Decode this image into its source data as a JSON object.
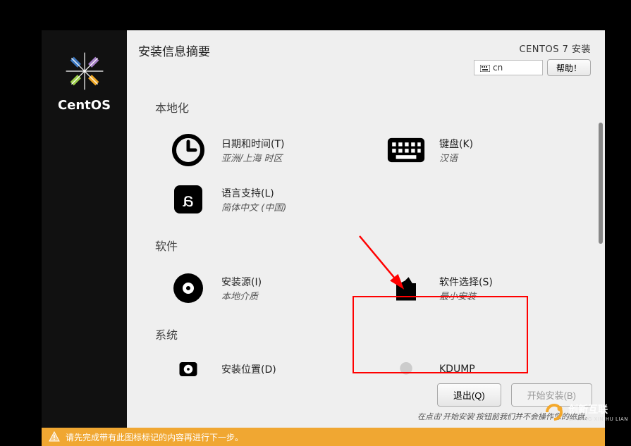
{
  "sidebar": {
    "brand": "CentOS"
  },
  "header": {
    "title_left": "安装信息摘要",
    "title_right": "CENTOS 7 安装",
    "keyboard_lang": "cn",
    "help_label": "帮助！"
  },
  "categories": [
    {
      "title": "本地化",
      "rows": [
        [
          {
            "icon": "clock-icon",
            "title": "日期和时间(T)",
            "sub": "亚洲/上海 时区"
          },
          {
            "icon": "keyboard-icon",
            "title": "键盘(K)",
            "sub": "汉语"
          }
        ],
        [
          {
            "icon": "language-icon",
            "title": "语言支持(L)",
            "sub": "简体中文 (中国)"
          }
        ]
      ]
    },
    {
      "title": "软件",
      "rows": [
        [
          {
            "icon": "disc-icon",
            "title": "安装源(I)",
            "sub": "本地介质"
          },
          {
            "icon": "package-icon",
            "title": "软件选择(S)",
            "sub": "最小安装",
            "highlighted": true
          }
        ]
      ]
    },
    {
      "title": "系统",
      "rows": [
        [
          {
            "icon": "disk-icon",
            "title": "安装位置(D)",
            "sub": ""
          },
          {
            "icon": "kdump-icon",
            "title": "KDUMP",
            "sub": ""
          }
        ]
      ]
    }
  ],
  "footer": {
    "quit_label": "退出(Q)",
    "begin_label": "开始安装(B)",
    "note": "在点击'开始安装'按钮前我们并不会操作您的磁盘。"
  },
  "warn": "请先完成带有此图标标记的内容再进行下一步。",
  "watermark": {
    "brand": "创新互联",
    "sub": "CHUANG XIN HU LIAN"
  }
}
